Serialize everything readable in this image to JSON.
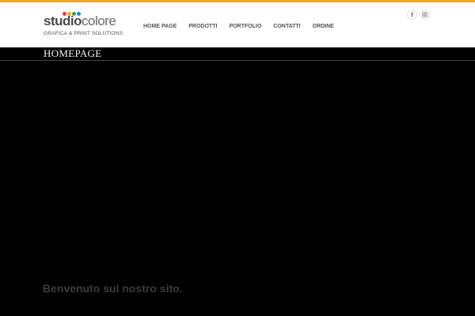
{
  "brand": {
    "name_bold": "studio",
    "name_light": "colore",
    "tagline": "GRAFICA & PRINT SOLUTIONS",
    "dot_colors": [
      "#e53935",
      "#f9a825",
      "#43a047",
      "#1e88e5"
    ]
  },
  "colors": {
    "top_stripe": "#f5a623",
    "header_bg": "#ffffff",
    "page_bg": "#000000"
  },
  "nav": {
    "items": [
      {
        "label": "HOME PAGE"
      },
      {
        "label": "PRODOTTI"
      },
      {
        "label": "PORTFOLIO"
      },
      {
        "label": "CONTATTI"
      },
      {
        "label": "ORDINE"
      }
    ]
  },
  "social": [
    {
      "icon": "facebook-icon"
    },
    {
      "icon": "instagram-icon"
    }
  ],
  "page": {
    "title": "HOMEPAGE",
    "welcome": "Benvenuto sul nostro sito."
  }
}
